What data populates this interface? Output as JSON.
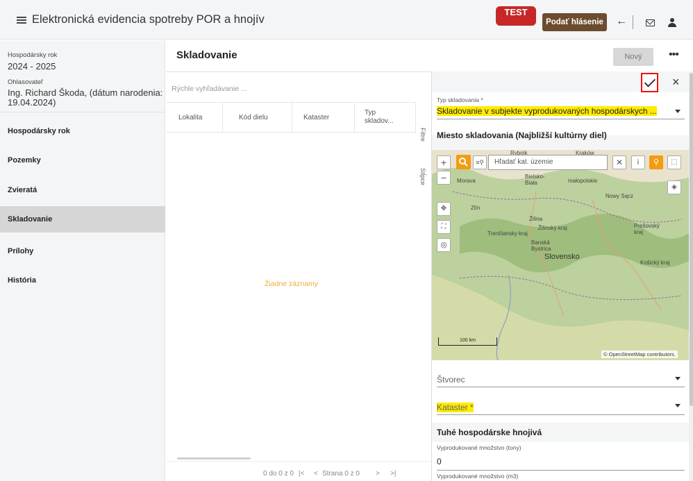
{
  "header": {
    "title": "Elektronická evidencia spotreby POR a hnojív",
    "test_badge": "TEST",
    "report_button": "Podať hlásenie",
    "back_icon": "←"
  },
  "sidebar": {
    "year_label": "Hospodársky rok",
    "year_value": "2024 - 2025",
    "reporter_label": "Ohlasovateľ",
    "reporter_value": "Ing. Richard Škoda, (dátum narodenia: 19.04.2024)",
    "items": [
      {
        "label": "Hospodársky rok"
      },
      {
        "label": "Pozemky"
      },
      {
        "label": "Zvieratá"
      },
      {
        "label": "Skladovanie"
      },
      {
        "label": "Prílohy"
      },
      {
        "label": "História"
      }
    ],
    "active_item": "Skladovanie"
  },
  "list": {
    "title": "Skladovanie",
    "new_button": "Nový",
    "more": "•••",
    "search_placeholder": "Rýchle vyhľadávanie ...",
    "columns": [
      "Lokalita",
      "Kód dielu",
      "Kataster",
      "Typ skladov..."
    ],
    "empty_message": "Žiadne záznamy",
    "filter_label": "Filtre",
    "columns_label": "Stĺpce",
    "pager": {
      "range": "0 do 0 z 0",
      "first": "|<",
      "prev": "<",
      "page_text": "Strana 0 z 0",
      "next": ">",
      "last": ">|"
    }
  },
  "detail": {
    "close": "×",
    "type_label": "Typ skladovania *",
    "type_value": "Skladovanie v subjekte vyprodukovaných hospodárskych ...",
    "location_section": "Miesto skladovania (Najbližší kultúrny diel)",
    "map": {
      "search_placeholder": "Hľadať kat. územie",
      "scale_label": "100 km",
      "credit": "© OpenStreetMap contributors.",
      "places": [
        "Rybnik",
        "Kraków",
        "Morava",
        "Bielsko-Biała",
        "małopolskie",
        "Nowy Sącz",
        "Zlín",
        "Žilina",
        "Žilinský kraj",
        "Trenčiansky kraj",
        "Prešovský kraj",
        "Banská Bystrica",
        "Slovensko",
        "Košický kraj"
      ]
    },
    "square_placeholder": "Štvorec",
    "cadastre_placeholder": "Kataster *",
    "solid_section": "Tuhé hospodárske hnojivá",
    "produced_tons_label": "Vyprodukované množstvo (tony)",
    "produced_tons_value": "0",
    "produced_m3_label": "Vyprodukované množstvo (m3)"
  }
}
